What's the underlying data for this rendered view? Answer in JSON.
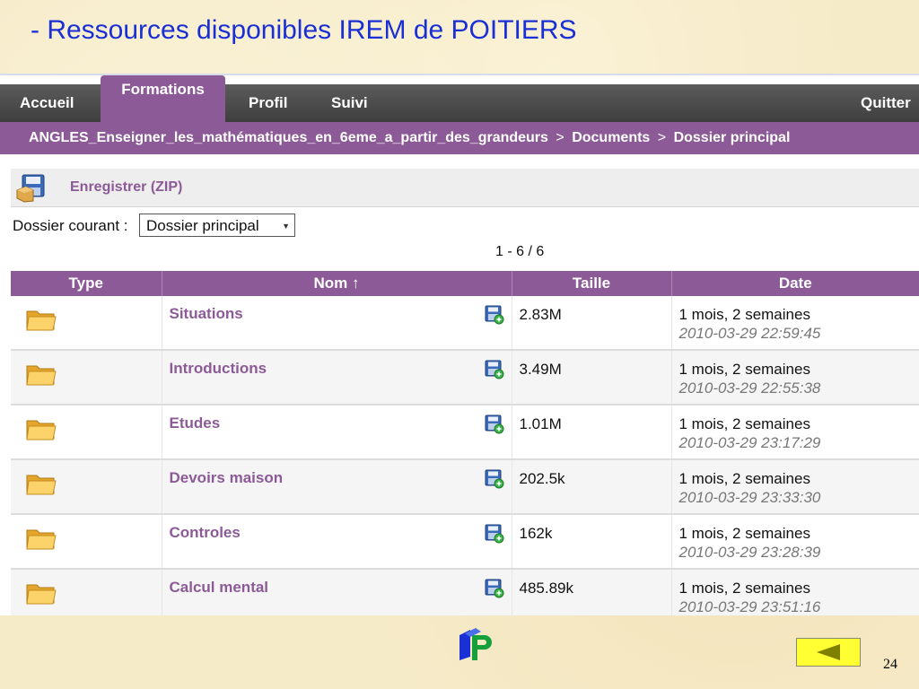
{
  "slide": {
    "title": "- Ressources disponibles IREM de POITIERS",
    "page_number": "24"
  },
  "nav": {
    "items": [
      {
        "label": "Accueil"
      },
      {
        "label": "Formations"
      },
      {
        "label": "Profil"
      },
      {
        "label": "Suivi"
      }
    ],
    "quit_label": "Quitter"
  },
  "breadcrumb": {
    "course": "ANGLES_Enseigner_les_mathématiques_en_6eme_a_partir_des_grandeurs",
    "separator": ">",
    "documents": "Documents",
    "folder": "Dossier principal"
  },
  "toolbar": {
    "save_zip_label": "Enregistrer (ZIP)"
  },
  "current_folder": {
    "label": "Dossier courant :",
    "selected": "Dossier principal"
  },
  "pager": "1 - 6 / 6",
  "table": {
    "headers": [
      "Type",
      "Nom ↑",
      "Taille",
      "Date"
    ],
    "rows": [
      {
        "name": "Situations",
        "size": "2.83M",
        "age": "1 mois, 2 semaines",
        "date": "2010-03-29 22:59:45"
      },
      {
        "name": "Introductions",
        "size": "3.49M",
        "age": "1 mois, 2 semaines",
        "date": "2010-03-29 22:55:38"
      },
      {
        "name": "Etudes",
        "size": "1.01M",
        "age": "1 mois, 2 semaines",
        "date": "2010-03-29 23:17:29"
      },
      {
        "name": "Devoirs maison",
        "size": "202.5k",
        "age": "1 mois, 2 semaines",
        "date": "2010-03-29 23:33:30"
      },
      {
        "name": "Controles",
        "size": "162k",
        "age": "1 mois, 2 semaines",
        "date": "2010-03-29 23:28:39"
      },
      {
        "name": "Calcul mental",
        "size": "485.89k",
        "age": "1 mois, 2 semaines",
        "date": "2010-03-29 23:51:16"
      }
    ]
  },
  "icons": {
    "folder": "folder-icon",
    "save": "save-zip-icon",
    "previous": "previous-arrow-icon"
  },
  "colors": {
    "title": "#1a2fd4",
    "accent_purple": "#8c5a96",
    "navbar": "#4a4a4a",
    "prev_button": "#ffff33"
  }
}
